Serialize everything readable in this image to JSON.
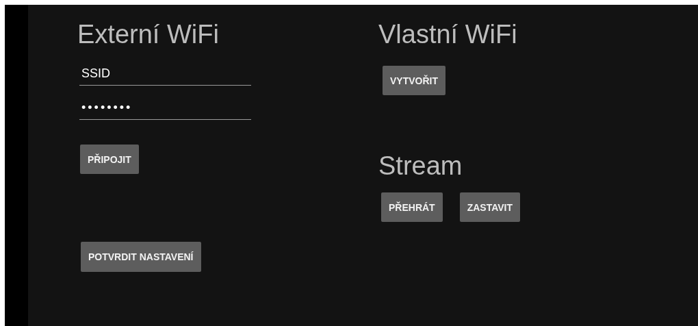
{
  "external_wifi": {
    "title": "Externí WiFi",
    "ssid": {
      "value": "SSID"
    },
    "password": {
      "value": "••••••••"
    },
    "connect_button": "PŘIPOJIT",
    "confirm_button": "POTVRDIT NASTAVENÍ"
  },
  "own_wifi": {
    "title": "Vlastní WiFi",
    "create_button": "VYTVOŘIT"
  },
  "stream": {
    "title": "Stream",
    "buttons": [
      "PŘEHRÁT",
      "ZASTAVIT"
    ]
  }
}
